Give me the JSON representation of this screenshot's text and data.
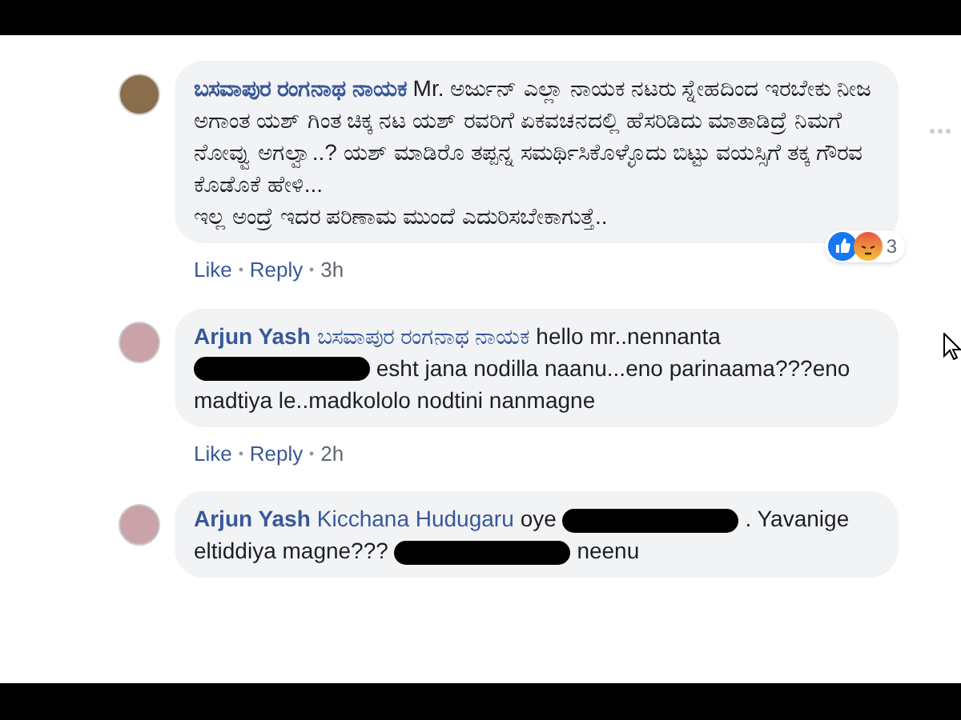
{
  "comments": [
    {
      "author": "ಬಸವಾಪುರ ರಂಗನಾಥ ನಾಯಕ",
      "segments": [
        {
          "kind": "text",
          "text": "Mr. ಅರ್ಜುನ್ ಎಲ್ಲಾ ನಾಯಕ ನಟರು ಸ್ನೇಹದಿಂದ ಇರಬೇಕು ನೀಜ ಅಗಾಂತ ಯಶ್ ಗಿಂತ ಚಿಕ್ಕ ನಟ ಯಶ್ ರವರಿಗೆ ಏಕವಚನದಲ್ಲಿ ಹೆಸರಿಡಿದು ಮಾತಾಡಿದ್ರೆ ನಿಮಗೆ ನೋವ್ವು ಅಗಲ್ವಾ..? ಯಶ್ ಮಾಡಿರೊ ತಪ್ಪನ್ನ ಸಮರ್ಥಿಸಿಕೊಳ್ಳೊದು ಬಿಟ್ಟು ವಯಸ್ಸಿಗೆ ತಕ್ಕ ಗೌರವ ಕೊಡೊಕೆ ಹೇಳಿ...\nಇಲ್ಲ ಅಂದ್ರೆ ಇದರ ಪರಿಣಾಮ ಮುಂದೆ ಎದುರಿಸಬೇಕಾಗುತ್ತೆ.."
        }
      ],
      "like": "Like",
      "reply": "Reply",
      "time": "3h",
      "reactions": {
        "count": "3"
      }
    },
    {
      "author": "Arjun Yash",
      "mention": "ಬಸವಾಪುರ ರಂಗನಾಥ ನಾಯಕ",
      "segments": [
        {
          "kind": "text",
          "text": "hello mr..nennanta"
        },
        {
          "kind": "redacted"
        },
        {
          "kind": "text",
          "text": "esht jana nodilla naanu...eno parinaama???eno madtiya le..madkololo nodtini nanmagne"
        }
      ],
      "like": "Like",
      "reply": "Reply",
      "time": "2h"
    },
    {
      "author": "Arjun Yash",
      "mention": "Kicchana Hudugaru",
      "segments": [
        {
          "kind": "text",
          "text": "oye"
        },
        {
          "kind": "redacted"
        },
        {
          "kind": "text",
          "text": ". Yavanige eltiddiya magne???"
        },
        {
          "kind": "redacted"
        },
        {
          "kind": "text",
          "text": "neenu"
        }
      ]
    }
  ]
}
